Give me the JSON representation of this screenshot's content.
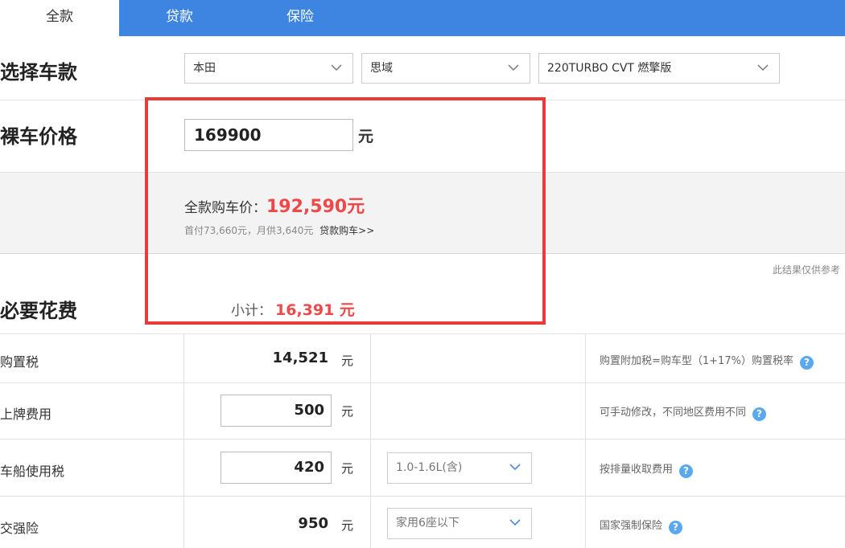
{
  "tabs": [
    {
      "label": "全款",
      "active": true
    },
    {
      "label": "贷款",
      "active": false
    },
    {
      "label": "保险",
      "active": false
    }
  ],
  "select_car": {
    "title": "选择车款",
    "brand": "本田",
    "series": "思域",
    "model": "220TURBO CVT 燃擎版"
  },
  "bare_price": {
    "title": "裸车价格",
    "value": "169900",
    "unit": "元"
  },
  "summary": {
    "full_label": "全款购车价：",
    "full_value": "192,590元",
    "loan_info": "首付73,660元，月供3,640元",
    "loan_link": "贷款购车>>",
    "disclaimer": "此结果仅供参考"
  },
  "required": {
    "title": "必要花费",
    "subtotal_label": "小计：",
    "subtotal_value": "16,391 元",
    "rows": [
      {
        "label": "购置税",
        "value": "14,521",
        "unit": "元",
        "note": "购置附加税=购车型（1+17%）购置税率"
      },
      {
        "label": "上牌费用",
        "value": "500",
        "unit": "元",
        "note": "可手动修改，不同地区费用不同"
      },
      {
        "label": "车船使用税",
        "value": "420",
        "unit": "元",
        "option": "1.0-1.6L(含)",
        "note": "按排量收取费用"
      },
      {
        "label": "交强险",
        "value": "950",
        "unit": "元",
        "option": "家用6座以下",
        "note": "国家强制保险"
      }
    ]
  },
  "icons": {
    "help": "?",
    "dropdown": "chevron-down-icon"
  },
  "colors": {
    "tab_bar": "#3d85e0",
    "accent_red": "#f04848",
    "highlight_box": "#ea3b3b",
    "help_icon": "#5aa9ef"
  }
}
